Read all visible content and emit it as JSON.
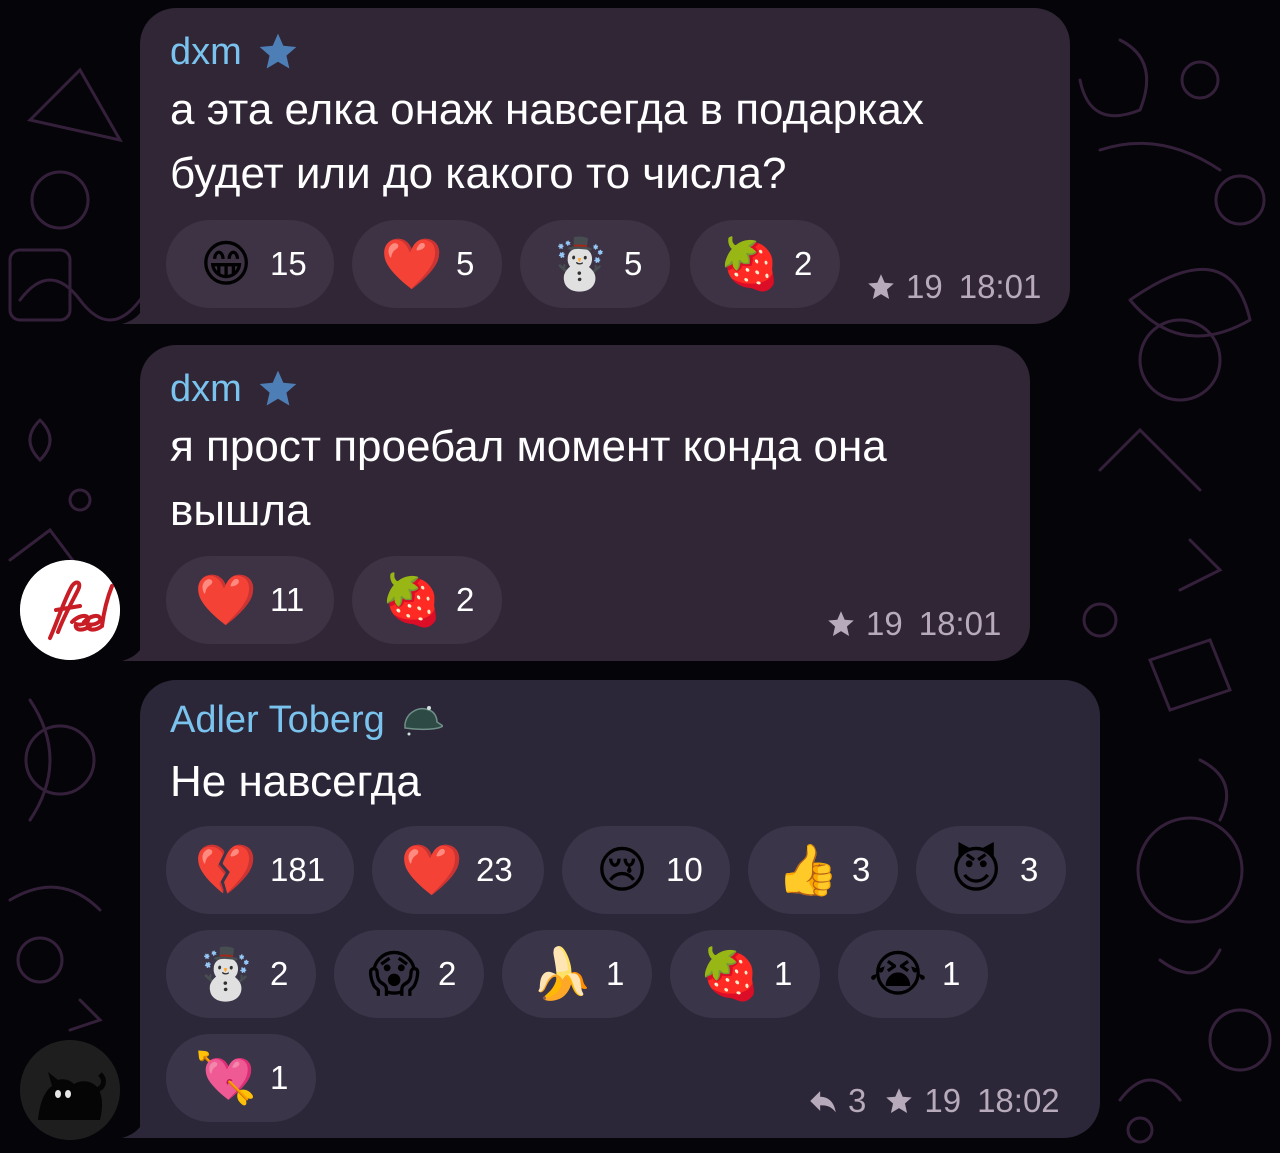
{
  "messages": [
    {
      "sender": "dxm",
      "sender_badge": "star-icon",
      "text": "а эта елка онаж навсегда в подарках\nбудет или до какого то числа?",
      "reactions": [
        {
          "icon": "grinning-face-icon",
          "glyph": "😁",
          "count": "15"
        },
        {
          "icon": "red-heart-icon",
          "glyph": "❤️",
          "count": "5"
        },
        {
          "icon": "snowman-icon",
          "glyph": "☃️",
          "count": "5"
        },
        {
          "icon": "strawberry-icon",
          "glyph": "🍓",
          "count": "2"
        }
      ],
      "stars": "19",
      "time": "18:01"
    },
    {
      "sender": "dxm",
      "sender_badge": "star-icon",
      "text": "я прост проебал момент конда она\nвышла",
      "reactions": [
        {
          "icon": "red-heart-icon",
          "glyph": "❤️",
          "count": "11"
        },
        {
          "icon": "strawberry-icon",
          "glyph": "🍓",
          "count": "2"
        }
      ],
      "stars": "19",
      "time": "18:01"
    },
    {
      "sender": "Adler Toberg",
      "sender_badge": "cap-icon",
      "text": "Не навсегда",
      "reactions": [
        {
          "icon": "broken-heart-icon",
          "glyph": "💔",
          "count": "181"
        },
        {
          "icon": "red-heart-icon",
          "glyph": "❤️",
          "count": "23"
        },
        {
          "icon": "crying-face-icon",
          "glyph": "😢",
          "count": "10"
        },
        {
          "icon": "thumbs-up-icon",
          "glyph": "👍",
          "count": "3"
        },
        {
          "icon": "smiling-devil-icon",
          "glyph": "😈",
          "count": "3"
        },
        {
          "icon": "snowman-icon",
          "glyph": "☃️",
          "count": "2"
        },
        {
          "icon": "screaming-face-icon",
          "glyph": "😱",
          "count": "2"
        },
        {
          "icon": "banana-icon",
          "glyph": "🍌",
          "count": "1"
        },
        {
          "icon": "strawberry-icon",
          "glyph": "🍓",
          "count": "1"
        },
        {
          "icon": "loudly-crying-face-icon",
          "glyph": "😭",
          "count": "1"
        },
        {
          "icon": "heart-with-arrow-icon",
          "glyph": "💘",
          "count": "1"
        }
      ],
      "replies": "3",
      "stars": "19",
      "time": "18:02"
    }
  ],
  "avatars": [
    {
      "icon": "feel-logo-avatar",
      "logo_text": "feel"
    },
    {
      "icon": "black-cat-avatar"
    }
  ],
  "colors": {
    "sender": "#79c3ee",
    "bubble": "#302636",
    "reaction_pill": "#3d3344",
    "meta_text": "#b7aabb",
    "background": "#050408"
  }
}
